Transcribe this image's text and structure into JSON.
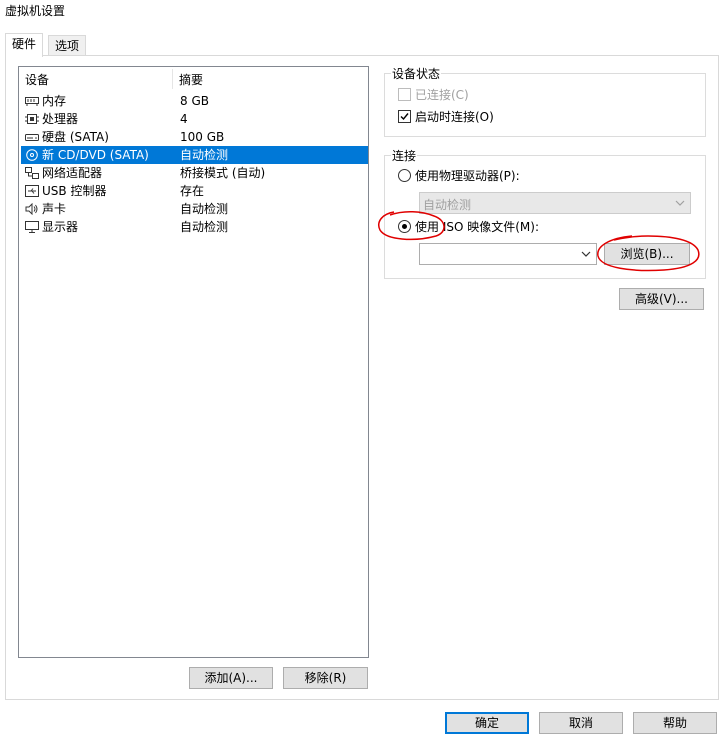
{
  "window": {
    "title": "虚拟机设置"
  },
  "tabs": [
    {
      "label": "硬件",
      "active": true
    },
    {
      "label": "选项",
      "active": false
    }
  ],
  "device_list": {
    "columns": [
      "设备",
      "摘要"
    ],
    "rows": [
      {
        "icon": "memory-icon",
        "name": "内存",
        "summary": "8 GB",
        "selected": false
      },
      {
        "icon": "processor-icon",
        "name": "处理器",
        "summary": "4",
        "selected": false
      },
      {
        "icon": "hard-disk-icon",
        "name": "硬盘 (SATA)",
        "summary": "100 GB",
        "selected": false
      },
      {
        "icon": "cd-dvd-icon",
        "name": "新 CD/DVD (SATA)",
        "summary": "自动检测",
        "selected": true
      },
      {
        "icon": "network-adapter-icon",
        "name": "网络适配器",
        "summary": "桥接模式 (自动)",
        "selected": false
      },
      {
        "icon": "usb-icon",
        "name": "USB 控制器",
        "summary": "存在",
        "selected": false
      },
      {
        "icon": "speaker-icon",
        "name": "声卡",
        "summary": "自动检测",
        "selected": false
      },
      {
        "icon": "monitor-icon",
        "name": "显示器",
        "summary": "自动检测",
        "selected": false
      }
    ],
    "add_button": "添加(A)...",
    "remove_button": "移除(R)"
  },
  "device_status": {
    "title": "设备状态",
    "connected": {
      "label": "已连接(C)",
      "checked": false,
      "enabled": false
    },
    "connect_at_power_on": {
      "label": "启动时连接(O)",
      "checked": true
    }
  },
  "connection": {
    "title": "连接",
    "physical_drive": {
      "label": "使用物理驱动器(P):",
      "selected": false
    },
    "physical_drive_select": {
      "value": "自动检测",
      "enabled": false
    },
    "iso_image": {
      "label": "使用 ISO 映像文件(M):",
      "selected": true
    },
    "iso_path": {
      "value": ""
    },
    "browse_button": "浏览(B)..."
  },
  "advanced_button": "高级(V)...",
  "footer": {
    "ok_button": "确定",
    "cancel_button": "取消",
    "help_button": "帮助"
  },
  "colors": {
    "selection": "#0078d7",
    "annotation": "#e00000"
  }
}
